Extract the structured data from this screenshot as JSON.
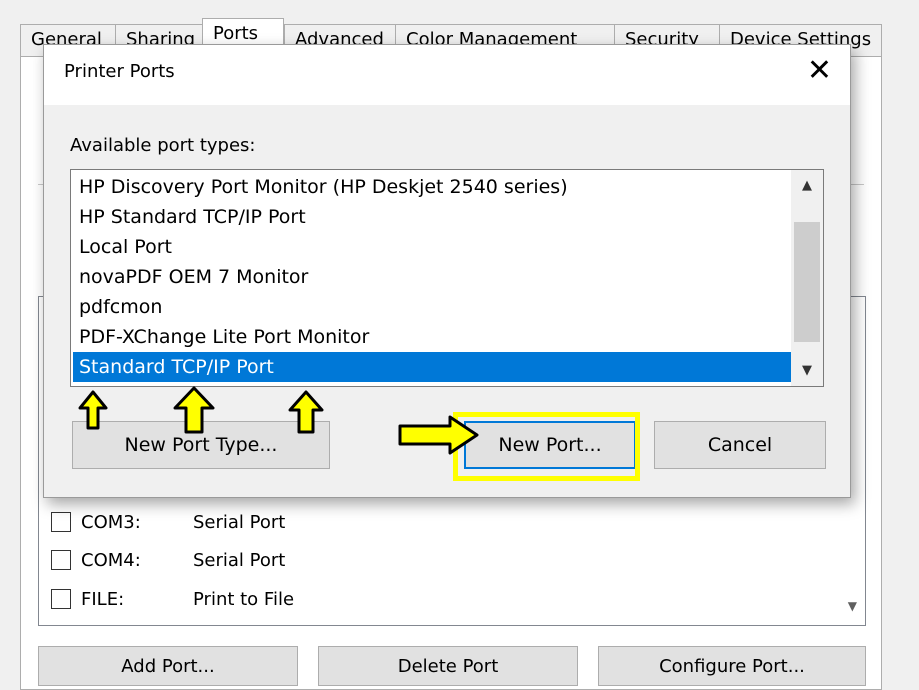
{
  "background": {
    "tabs": [
      "General",
      "Sharing",
      "Ports",
      "Advanced",
      "Color Management",
      "Security",
      "Device Settings"
    ],
    "ports": [
      {
        "name": "COM3:",
        "description": "Serial Port"
      },
      {
        "name": "COM4:",
        "description": "Serial Port"
      },
      {
        "name": "FILE:",
        "description": "Print to File"
      }
    ],
    "buttons": {
      "add_port": "Add Port...",
      "delete_port": "Delete Port",
      "configure_port": "Configure Port..."
    }
  },
  "dialog": {
    "title": "Printer Ports",
    "close_glyph": "✕",
    "label": "Available port types:",
    "port_types": [
      "HP Discovery Port Monitor (HP Deskjet 2540 series)",
      "HP Standard TCP/IP Port",
      "Local Port",
      "novaPDF OEM 7 Monitor",
      "pdfcmon",
      "PDF-XChange Lite Port Monitor",
      "Standard TCP/IP Port"
    ],
    "selected_index": 6,
    "buttons": {
      "new_port_type": "New Port Type...",
      "new_port": "New Port...",
      "cancel": "Cancel"
    }
  },
  "colors": {
    "selection": "#0078d7",
    "annotation_fill": "#ffff00",
    "annotation_outline": "#000000"
  }
}
